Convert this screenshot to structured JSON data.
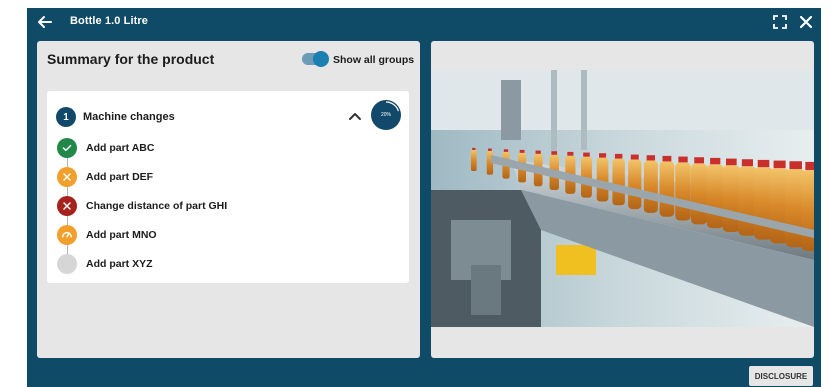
{
  "window": {
    "title": "Bottle 1.0 Litre",
    "icons": {
      "back": "arrow-left-icon",
      "fullscreen": "fullscreen-icon",
      "close": "close-icon"
    }
  },
  "summary": {
    "title": "Summary for the product",
    "toggle": {
      "label": "Show all groups",
      "on": true
    }
  },
  "group": {
    "number": "1",
    "title": "Machine changes",
    "progress_label": "20%",
    "progress_fraction": 0.2,
    "expanded": true
  },
  "steps": [
    {
      "label": "Add part ABC",
      "status": "done",
      "color": "#21884a",
      "icon": "check-icon"
    },
    {
      "label": "Add part DEF",
      "status": "warning",
      "color": "#f2a02c",
      "icon": "close-icon"
    },
    {
      "label": "Change distance of part GHI",
      "status": "error",
      "color": "#a5221d",
      "icon": "close-icon"
    },
    {
      "label": "Add part MNO",
      "status": "in-progress",
      "color": "#f2a02c",
      "icon": "gauge-icon"
    },
    {
      "label": "Add part XYZ",
      "status": "pending",
      "color": "#d6d6d6",
      "icon": "none"
    }
  ],
  "image": {
    "icon": "bottling-line-photo"
  },
  "footer": {
    "disclosure_label": "DISCLOSURE"
  },
  "colors": {
    "primary": "#0f4a66",
    "accent": "#1b7fb0",
    "panel": "#e6e6e6"
  }
}
